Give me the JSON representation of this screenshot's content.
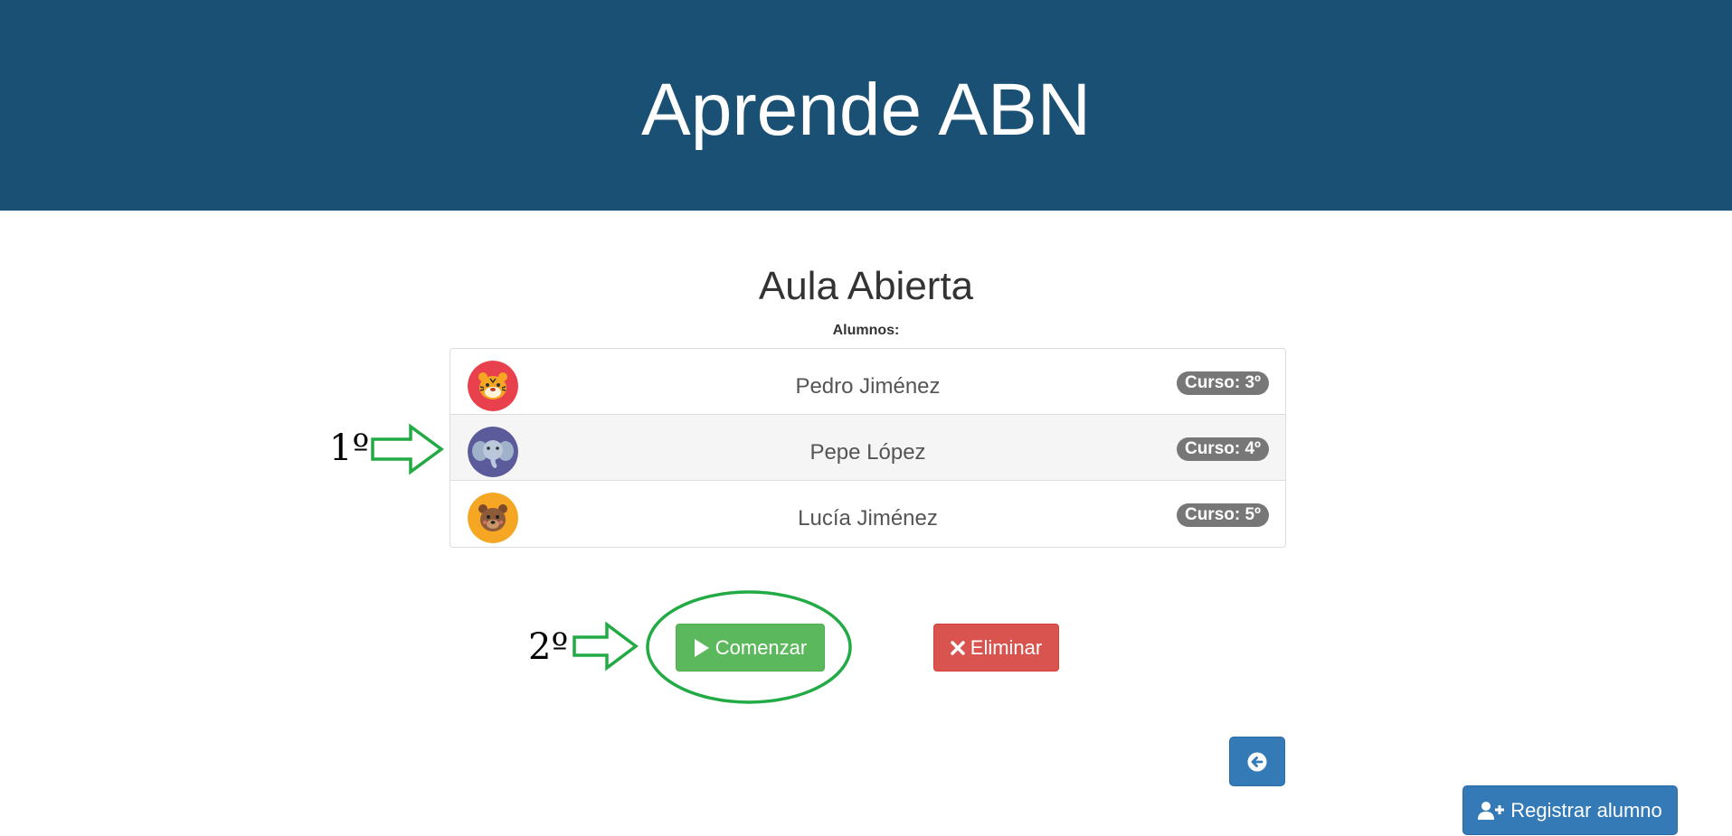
{
  "header": {
    "title": "Aprende ABN",
    "bg_color": "#1b5075"
  },
  "page": {
    "title": "Aula Abierta",
    "list_label": "Alumnos:"
  },
  "students": [
    {
      "name": "Pedro Jiménez",
      "course": "Curso: 3º",
      "avatar": "tiger-icon",
      "avatar_color": "#e8414d"
    },
    {
      "name": "Pepe López",
      "course": "Curso: 4º",
      "avatar": "elephant-icon",
      "avatar_color": "#5b5b9c",
      "selected": true
    },
    {
      "name": "Lucía Jiménez",
      "course": "Curso: 5º",
      "avatar": "bear-icon",
      "avatar_color": "#f5a623"
    }
  ],
  "annotations": {
    "step1": "1º",
    "step2": "2º",
    "color": "#22aa44"
  },
  "actions": {
    "start_label": "Comenzar",
    "start_icon": "play-icon",
    "delete_label": "Eliminar",
    "delete_icon": "close-icon",
    "back_icon": "arrow-circle-left-icon",
    "register_label": "Registrar alumno",
    "register_icon": "user-plus-icon"
  }
}
